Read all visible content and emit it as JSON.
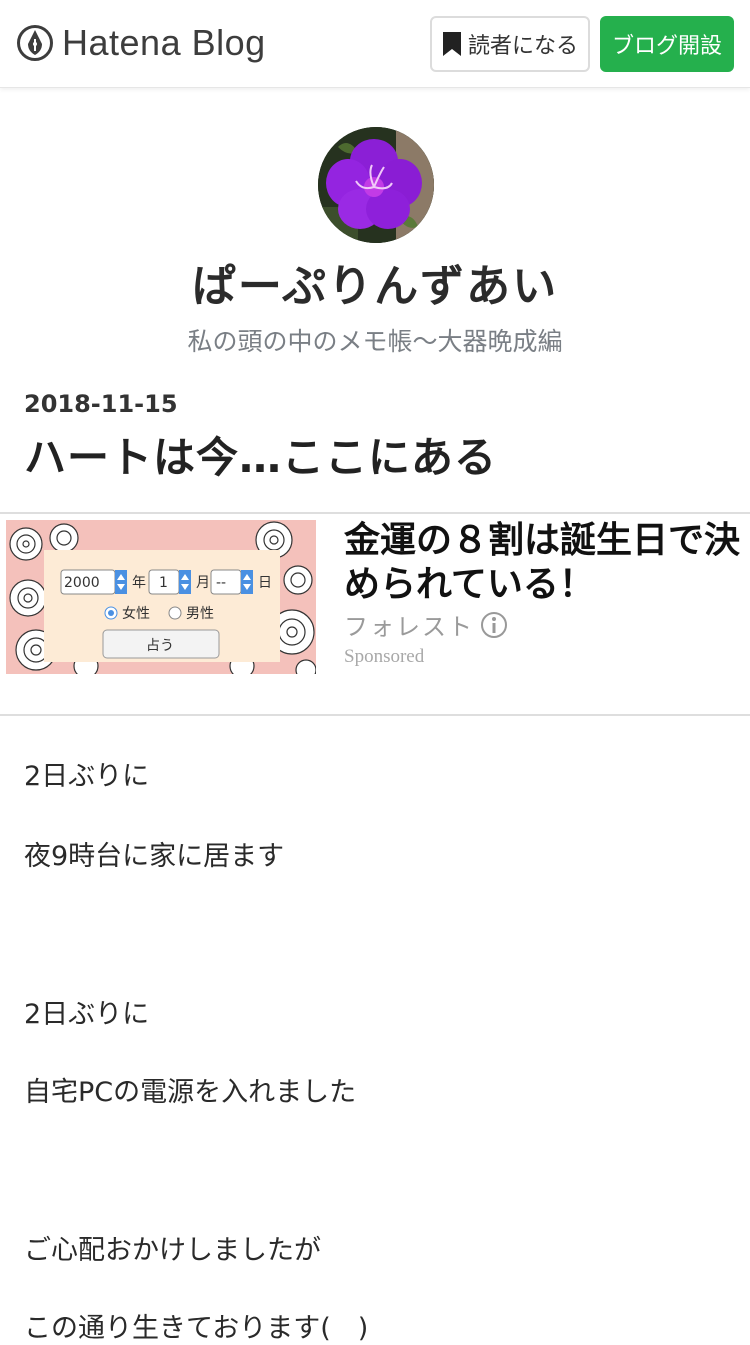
{
  "header": {
    "logo_text": "Hatena Blog",
    "subscribe_label": "読者になる",
    "open_blog_label": "ブログ開設",
    "accent_color": "#25b04d"
  },
  "blog": {
    "title": "ぱーぷりんずあい",
    "description": "私の頭の中のメモ帳～大器晩成編"
  },
  "entry": {
    "date": "2018-11-15",
    "title": "ハートは今…ここにある"
  },
  "ad": {
    "title": "金運の８割は誕生日で決められている！",
    "advertiser": "フォレスト",
    "sponsored": "Sponsored",
    "form": {
      "year": "2000",
      "year_unit": "年",
      "month": "1",
      "month_unit": "月",
      "day": "--",
      "day_unit": "日",
      "female": "女性",
      "male": "男性",
      "submit": "占う"
    }
  },
  "body": {
    "paragraphs": [
      "2日ぶりに",
      "夜9時台に家に居ます",
      "2日ぶりに",
      "自宅PCの電源を入れました",
      "ご心配おかけしましたが",
      "この通り生きております(　)"
    ]
  }
}
